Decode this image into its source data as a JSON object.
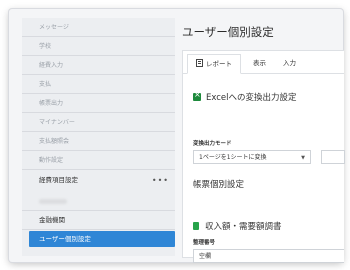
{
  "sidebar": {
    "items": [
      {
        "label": "メッセージ"
      },
      {
        "label": "学校"
      },
      {
        "label": "経費入力"
      },
      {
        "label": "支払"
      },
      {
        "label": "帳票出力"
      },
      {
        "label": "マイナンバー"
      },
      {
        "label": "支払額照会"
      },
      {
        "label": "動作設定"
      },
      {
        "label": "経費項目設定",
        "more": "•••"
      },
      {
        "label": "金融機関"
      },
      {
        "label": "ユーザー個別設定"
      }
    ]
  },
  "main": {
    "title": "ユーザー個別設定",
    "tabs": [
      {
        "label": "レポート"
      },
      {
        "label": "表示"
      },
      {
        "label": "入力"
      }
    ],
    "excel_section": {
      "heading": "Excelへの変換出力設定",
      "mode_label": "変換出力モード",
      "mode_value": "1ページを1シートに変換"
    },
    "form_section": {
      "heading": "帳票個別設定",
      "doc_heading": "収入額・需要額調書",
      "field_label": "整理番号",
      "field_value": "空欄"
    }
  },
  "colors": {
    "accent": "#2f86d6",
    "excel_green": "#1e8a3c"
  }
}
